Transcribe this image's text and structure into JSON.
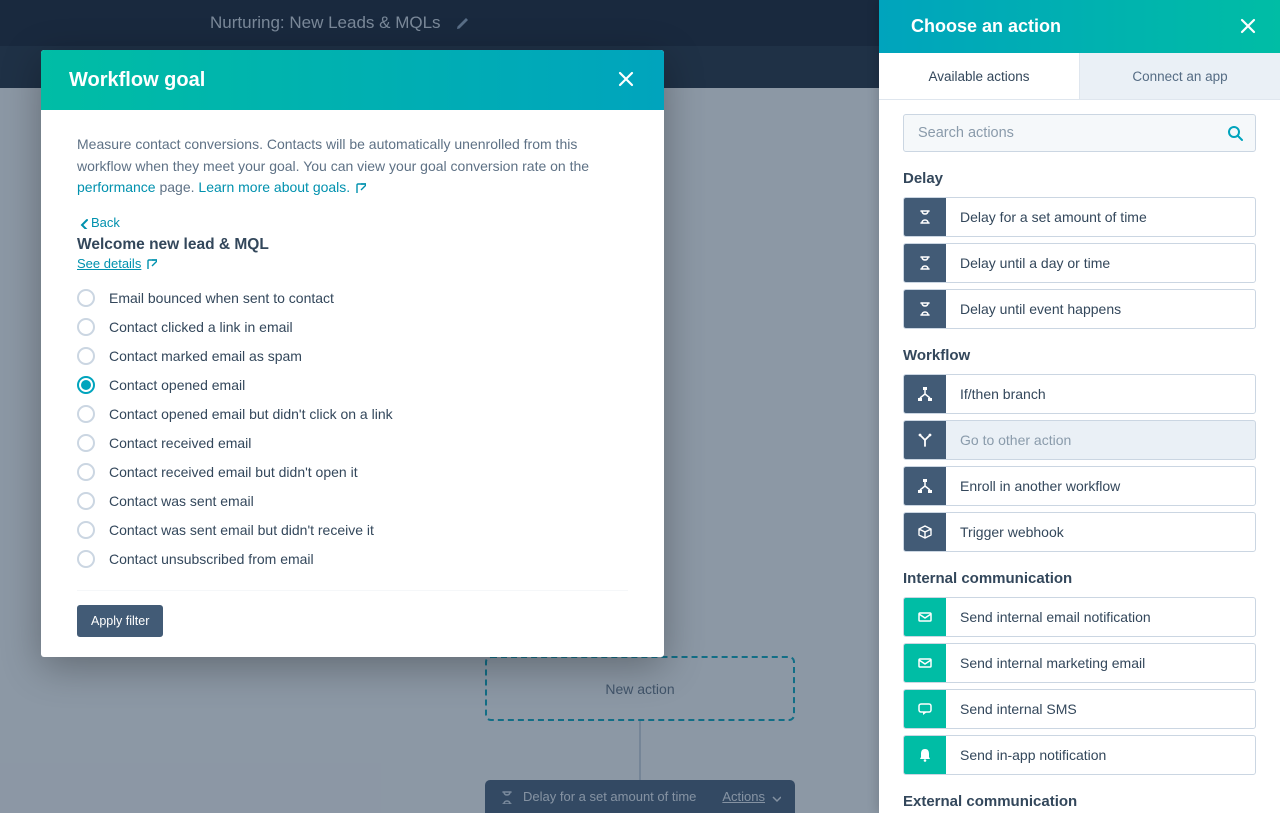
{
  "page": {
    "title": "Nurturing: New Leads & MQLs",
    "new_action_label": "New action",
    "delay_card_label": "Delay for a set amount of time",
    "delay_card_menu": "Actions"
  },
  "modal": {
    "title": "Workflow goal",
    "desc_part1": "Measure contact conversions. Contacts will be automatically unenrolled from this workflow when they meet your goal. You can view your goal conversion rate on the ",
    "link_perf": "performance",
    "desc_part2": " page. ",
    "link_learn": "Learn more about goals.",
    "back": "Back",
    "goal_name": "Welcome new lead & MQL",
    "see_details": "See details",
    "radios": [
      {
        "label": "Email bounced when sent to contact",
        "selected": false
      },
      {
        "label": "Contact clicked a link in email",
        "selected": false
      },
      {
        "label": "Contact marked email as spam",
        "selected": false
      },
      {
        "label": "Contact opened email",
        "selected": true
      },
      {
        "label": "Contact opened email but didn't click on a link",
        "selected": false
      },
      {
        "label": "Contact received email",
        "selected": false
      },
      {
        "label": "Contact received email but didn't open it",
        "selected": false
      },
      {
        "label": "Contact was sent email",
        "selected": false
      },
      {
        "label": "Contact was sent email but didn't receive it",
        "selected": false
      },
      {
        "label": "Contact unsubscribed from email",
        "selected": false
      }
    ],
    "apply": "Apply filter"
  },
  "panel": {
    "title": "Choose an action",
    "tab_available": "Available actions",
    "tab_connect": "Connect an app",
    "search_placeholder": "Search actions",
    "cat_delay": "Delay",
    "cat_workflow": "Workflow",
    "cat_internal": "Internal communication",
    "cat_external": "External communication",
    "actions": {
      "delay_set": "Delay for a set amount of time",
      "delay_day": "Delay until a day or time",
      "delay_event": "Delay until event happens",
      "branch": "If/then branch",
      "goto": "Go to other action",
      "enroll": "Enroll in another workflow",
      "webhook": "Trigger webhook",
      "int_email": "Send internal email notification",
      "int_marketing": "Send internal marketing email",
      "int_sms": "Send internal SMS",
      "int_app": "Send in-app notification"
    }
  }
}
